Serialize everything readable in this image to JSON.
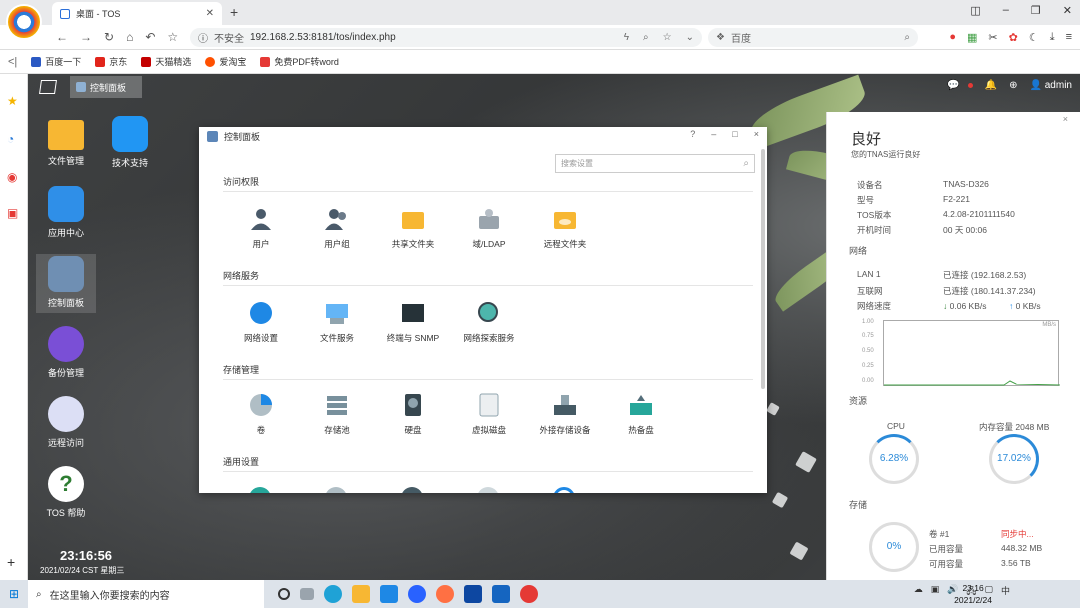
{
  "browser": {
    "tab_title": "桌面 - TOS",
    "insecure": "不安全",
    "url": "192.168.2.53:8181/tos/index.php",
    "search_engine": "百度",
    "bookmarks": [
      "百度一下",
      "京东",
      "天猫精选",
      "爱淘宝",
      "免费PDF转word"
    ]
  },
  "tos": {
    "taskbar_item": "控制面板",
    "user": "admin",
    "desktop_icons": [
      "文件管理",
      "技术支持",
      "应用中心",
      "控制面板",
      "备份管理",
      "远程访问",
      "TOS 帮助"
    ],
    "time": "23:16:56",
    "date": "2021/02/24 CST 星期三"
  },
  "control_panel": {
    "title": "控制面板",
    "controls": [
      "?",
      "–",
      "□",
      "×"
    ],
    "search_placeholder": "搜索设置",
    "sections": [
      {
        "name": "访问权限",
        "items": [
          "用户",
          "用户组",
          "共享文件夹",
          "域/LDAP",
          "远程文件夹"
        ]
      },
      {
        "name": "网络服务",
        "items": [
          "网络设置",
          "文件服务",
          "终端与 SNMP",
          "网络探索服务"
        ]
      },
      {
        "name": "存储管理",
        "items": [
          "卷",
          "存储池",
          "硬盘",
          "虚拟磁盘",
          "外接存储设备",
          "热备盘"
        ]
      },
      {
        "name": "通用设置",
        "items": []
      }
    ]
  },
  "status": {
    "close": "×",
    "title": "良好",
    "subtitle": "您的TNAS运行良好",
    "device_label": "设备名",
    "device": "TNAS-D326",
    "model_label": "型号",
    "model": "F2-221",
    "tos_label": "TOS版本",
    "tos_version": "4.2.08-2101111540",
    "uptime_label": "开机时间",
    "uptime": "00 天 00:06",
    "network_section": "网络",
    "lan_label": "LAN 1",
    "lan": "已连接 (192.168.2.53)",
    "internet_label": "互联网",
    "internet": "已连接 (180.141.37.234)",
    "speed_label": "网络速度",
    "down": "0.06 KB/s",
    "up": "0 KB/s",
    "graph_unit": "MB/s",
    "graph_ticks": [
      "1.00",
      "0.75",
      "0.50",
      "0.25",
      "0.00"
    ],
    "resources_section": "资源",
    "cpu_label": "CPU",
    "cpu": "6.28%",
    "mem_label": "内存容量 2048 MB",
    "mem": "17.02%",
    "storage_section": "存储",
    "vol_usage": "0%",
    "vol_name": "卷 #1",
    "vol_status": "同步中...",
    "used_label": "已用容量",
    "used": "448.32 MB",
    "avail_label": "可用容量",
    "avail": "3.56 TB"
  },
  "taskbar": {
    "search_placeholder": "在这里输入你要搜索的内容",
    "time": "23:16",
    "date": "2021/2/24"
  }
}
